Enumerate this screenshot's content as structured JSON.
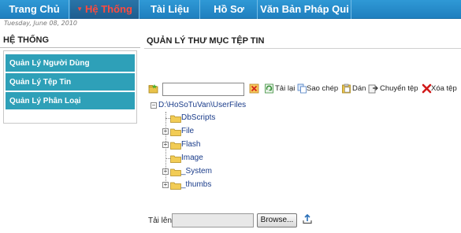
{
  "nav": {
    "items": [
      {
        "label": "Trang Chủ"
      },
      {
        "label": "Hệ Thống",
        "active": true
      },
      {
        "label": "Tài Liệu"
      },
      {
        "label": "Hồ Sơ"
      },
      {
        "label": "Văn Bản Pháp Qui"
      }
    ],
    "caret": "▼",
    "bar_color": "#1f7fbf",
    "active_text_color": "#ff4a3d"
  },
  "date": "Tuesday, June 08, 2010",
  "sidebar": {
    "title": "HỆ THỐNG",
    "items": [
      {
        "label": "Quản Lý Người Dùng"
      },
      {
        "label": "Quản Lý Tệp Tin"
      },
      {
        "label": "Quản Lý Phân Loại"
      }
    ],
    "item_color": "#2ea0b8"
  },
  "main": {
    "title": "QUẢN LÝ THƯ MỤC TỆP TIN",
    "toolbar": {
      "new_folder_icon": "new-folder-icon",
      "input_value": "",
      "clear_icon": "clear-icon",
      "reload_label": "Tải lại",
      "copy_label": "Sao chép",
      "paste_label": "Dán",
      "move_label": "Chuyển tệp",
      "delete_label": "Xóa tệp"
    },
    "tree": {
      "root": "D:\\HoSoTuVan\\UserFiles",
      "children": [
        {
          "label": "DbScripts",
          "expandable": false
        },
        {
          "label": "File",
          "expandable": true
        },
        {
          "label": "Flash",
          "expandable": true
        },
        {
          "label": "Image",
          "expandable": false
        },
        {
          "label": "_System",
          "expandable": true
        },
        {
          "label": "_thumbs",
          "expandable": true
        }
      ]
    },
    "upload": {
      "label": "Tải lên",
      "file_value": "",
      "browse_label": "Browse...",
      "upload_icon": "upload-icon"
    }
  }
}
